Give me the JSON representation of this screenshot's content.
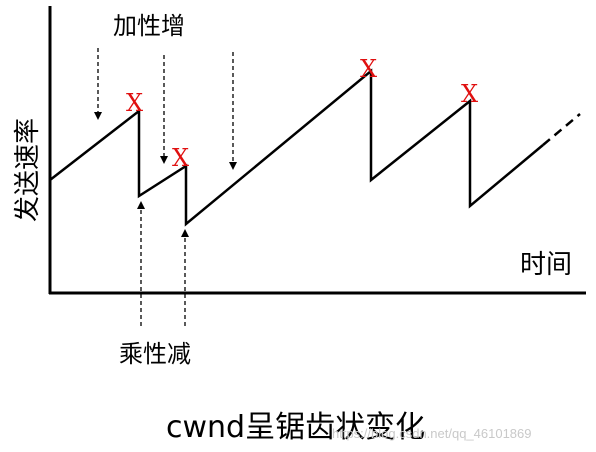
{
  "labels": {
    "y_axis": "发送速率",
    "x_axis": "时间",
    "additive_increase": "加性增",
    "multiplicative_decrease": "乘性减",
    "caption": "cwnd呈锯齿状变化",
    "loss_marker": "X"
  },
  "watermark": "https://blog.csdn.net/qq_46101869",
  "colors": {
    "line": "#000000",
    "loss_marker": "#e01010",
    "watermark": "#c9c9c9"
  }
}
